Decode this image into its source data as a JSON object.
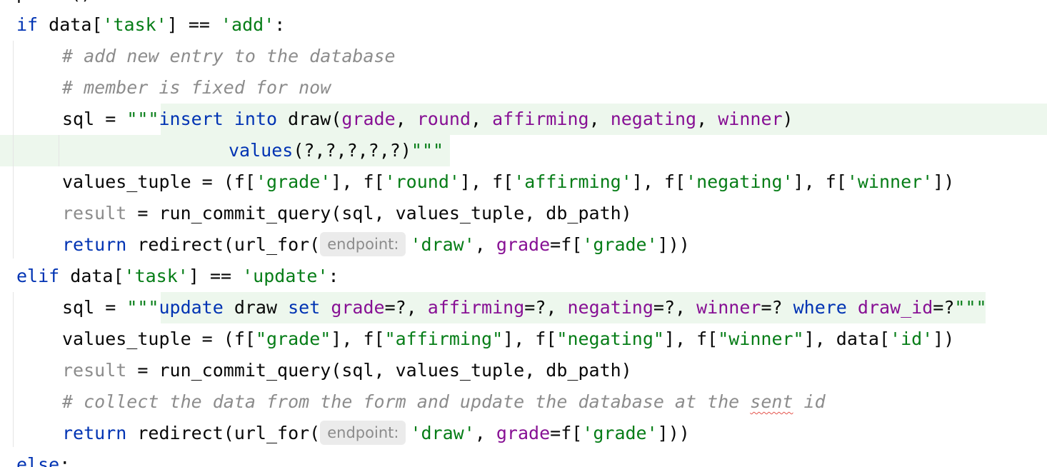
{
  "lines": [
    {
      "id": "l0",
      "tokens": [
        {
          "t": "print()",
          "c": "punc"
        }
      ]
    },
    {
      "id": "l1",
      "tokens": [
        {
          "t": "if",
          "c": "kw"
        },
        {
          "t": " data[",
          "c": "punc"
        },
        {
          "t": "'task'",
          "c": "str"
        },
        {
          "t": "] == ",
          "c": "punc"
        },
        {
          "t": "'add'",
          "c": "str"
        },
        {
          "t": ":",
          "c": "punc"
        }
      ]
    },
    {
      "id": "l2",
      "tokens": [
        {
          "t": "# add new entry to the database",
          "c": "cm"
        }
      ]
    },
    {
      "id": "l3",
      "tokens": [
        {
          "t": "# member is fixed for now",
          "c": "cm"
        }
      ]
    },
    {
      "id": "l4",
      "tokens": [
        {
          "t": "sql = ",
          "c": "punc"
        },
        {
          "t": "\"\"\"",
          "c": "str"
        },
        {
          "t": "insert",
          "c": "sqlkw"
        },
        {
          "t": " ",
          "c": "punc"
        },
        {
          "t": "into",
          "c": "sqlkw"
        },
        {
          "t": " draw(",
          "c": "punc"
        },
        {
          "t": "grade",
          "c": "sqlid"
        },
        {
          "t": ", ",
          "c": "punc"
        },
        {
          "t": "round",
          "c": "sqlid"
        },
        {
          "t": ", ",
          "c": "punc"
        },
        {
          "t": "affirming",
          "c": "sqlid"
        },
        {
          "t": ", ",
          "c": "punc"
        },
        {
          "t": "negating",
          "c": "sqlid"
        },
        {
          "t": ", ",
          "c": "punc"
        },
        {
          "t": "winner",
          "c": "sqlid"
        },
        {
          "t": ")",
          "c": "punc"
        }
      ]
    },
    {
      "id": "l5",
      "tokens": [
        {
          "t": "values",
          "c": "sqlkw"
        },
        {
          "t": "(?,?,?,?,?)",
          "c": "punc"
        },
        {
          "t": "\"\"\"",
          "c": "str"
        }
      ]
    },
    {
      "id": "l6",
      "tokens": [
        {
          "t": "values_tuple = (f[",
          "c": "punc"
        },
        {
          "t": "'grade'",
          "c": "str"
        },
        {
          "t": "], f[",
          "c": "punc"
        },
        {
          "t": "'round'",
          "c": "str"
        },
        {
          "t": "], f[",
          "c": "punc"
        },
        {
          "t": "'affirming'",
          "c": "str"
        },
        {
          "t": "], f[",
          "c": "punc"
        },
        {
          "t": "'negating'",
          "c": "str"
        },
        {
          "t": "], f[",
          "c": "punc"
        },
        {
          "t": "'winner'",
          "c": "str"
        },
        {
          "t": "])",
          "c": "punc"
        }
      ]
    },
    {
      "id": "l7",
      "tokens": [
        {
          "t": "result",
          "c": "dim"
        },
        {
          "t": " = run_commit_query(sql, values_tuple, db_path)",
          "c": "punc"
        }
      ]
    },
    {
      "id": "l8",
      "tokens": [
        {
          "t": "return",
          "c": "kw"
        },
        {
          "t": " redirect(url_for(",
          "c": "punc"
        },
        {
          "t": "endpoint:",
          "c": "hint"
        },
        {
          "t": "'draw'",
          "c": "str"
        },
        {
          "t": ", ",
          "c": "punc"
        },
        {
          "t": "grade",
          "c": "sqlid"
        },
        {
          "t": "=f[",
          "c": "punc"
        },
        {
          "t": "'grade'",
          "c": "str"
        },
        {
          "t": "]))",
          "c": "punc"
        }
      ]
    },
    {
      "id": "l9",
      "tokens": [
        {
          "t": "elif",
          "c": "kw"
        },
        {
          "t": " data[",
          "c": "punc"
        },
        {
          "t": "'task'",
          "c": "str"
        },
        {
          "t": "] == ",
          "c": "punc"
        },
        {
          "t": "'update'",
          "c": "str"
        },
        {
          "t": ":",
          "c": "punc"
        }
      ]
    },
    {
      "id": "l10",
      "tokens": [
        {
          "t": "sql = ",
          "c": "punc"
        },
        {
          "t": "\"\"\"",
          "c": "str"
        },
        {
          "t": "update",
          "c": "sqlkw"
        },
        {
          "t": " draw ",
          "c": "punc"
        },
        {
          "t": "set",
          "c": "sqlkw"
        },
        {
          "t": " ",
          "c": "punc"
        },
        {
          "t": "grade",
          "c": "sqlid"
        },
        {
          "t": "=?, ",
          "c": "punc"
        },
        {
          "t": "affirming",
          "c": "sqlid"
        },
        {
          "t": "=?, ",
          "c": "punc"
        },
        {
          "t": "negating",
          "c": "sqlid"
        },
        {
          "t": "=?, ",
          "c": "punc"
        },
        {
          "t": "winner",
          "c": "sqlid"
        },
        {
          "t": "=? ",
          "c": "punc"
        },
        {
          "t": "where",
          "c": "sqlkw"
        },
        {
          "t": " ",
          "c": "punc"
        },
        {
          "t": "draw_id",
          "c": "sqlid"
        },
        {
          "t": "=?",
          "c": "punc"
        },
        {
          "t": "\"\"\"",
          "c": "str"
        }
      ]
    },
    {
      "id": "l11",
      "tokens": [
        {
          "t": "values_tuple = (f[",
          "c": "punc"
        },
        {
          "t": "\"grade\"",
          "c": "str"
        },
        {
          "t": "], f[",
          "c": "punc"
        },
        {
          "t": "\"affirming\"",
          "c": "str"
        },
        {
          "t": "], f[",
          "c": "punc"
        },
        {
          "t": "\"negating\"",
          "c": "str"
        },
        {
          "t": "], f[",
          "c": "punc"
        },
        {
          "t": "\"winner\"",
          "c": "str"
        },
        {
          "t": "], data[",
          "c": "punc"
        },
        {
          "t": "'id'",
          "c": "str"
        },
        {
          "t": "])",
          "c": "punc"
        }
      ]
    },
    {
      "id": "l12",
      "tokens": [
        {
          "t": "result",
          "c": "dim"
        },
        {
          "t": " = run_commit_query(sql, values_tuple, db_path)",
          "c": "punc"
        }
      ]
    },
    {
      "id": "l13",
      "tokens": [
        {
          "t": "# collect the data from the form and update the database at the ",
          "c": "cm"
        },
        {
          "t": "sent",
          "c": "cm typo"
        },
        {
          "t": " id",
          "c": "cm"
        }
      ]
    },
    {
      "id": "l14",
      "tokens": [
        {
          "t": "return",
          "c": "kw"
        },
        {
          "t": " redirect(url_for(",
          "c": "punc"
        },
        {
          "t": "endpoint:",
          "c": "hint"
        },
        {
          "t": "'draw'",
          "c": "str"
        },
        {
          "t": ", ",
          "c": "punc"
        },
        {
          "t": "grade",
          "c": "sqlid"
        },
        {
          "t": "=f[",
          "c": "punc"
        },
        {
          "t": "'grade'",
          "c": "str"
        },
        {
          "t": "]))",
          "c": "punc"
        }
      ]
    },
    {
      "id": "l15",
      "tokens": [
        {
          "t": "else",
          "c": "kw"
        },
        {
          "t": ":",
          "c": "punc"
        }
      ]
    }
  ]
}
